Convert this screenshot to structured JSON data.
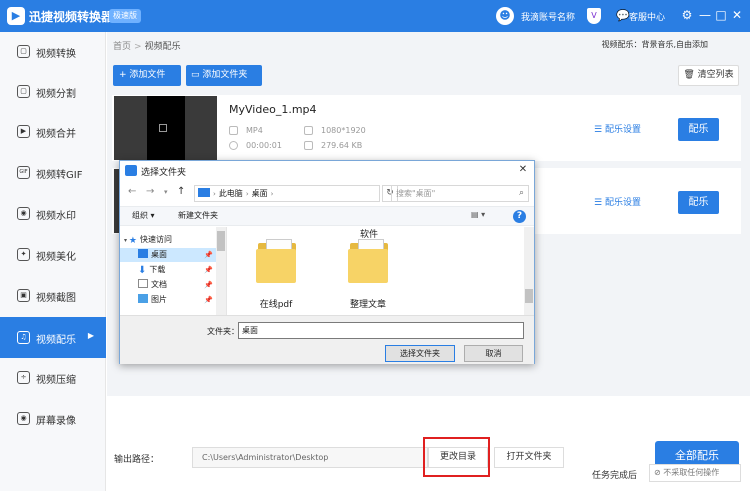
{
  "app": {
    "title": "迅捷视频转换器",
    "badge": "极速版",
    "user_name": "我滴账号名称",
    "vip_icon": "V",
    "service_label": "客服中心",
    "controls": [
      "⚙",
      "—",
      "□",
      "✕"
    ]
  },
  "sidebar": {
    "items": [
      {
        "label": "视频转换",
        "icon": "▢"
      },
      {
        "label": "视频分割",
        "icon": "▢"
      },
      {
        "label": "视频合并",
        "icon": "▶"
      },
      {
        "label": "视频转GIF",
        "icon": "GIF"
      },
      {
        "label": "视频水印",
        "icon": "◉"
      },
      {
        "label": "视频美化",
        "icon": "✦"
      },
      {
        "label": "视频截图",
        "icon": "▣"
      },
      {
        "label": "视频配乐",
        "icon": "♫",
        "active": true
      },
      {
        "label": "视频压缩",
        "icon": "÷"
      },
      {
        "label": "屏幕录像",
        "icon": "◉"
      }
    ]
  },
  "breadcrumb": {
    "home": "首页",
    "sep": ">",
    "current": "视频配乐"
  },
  "mode_label": "视频配乐：背景音乐,自由添加",
  "toolbar": {
    "add_file": "+ 添加文件",
    "add_folder": "添加文件夹",
    "clear_list": "清空列表"
  },
  "videos": [
    {
      "name": "MyVideo_1.mp4",
      "format": "MP4",
      "resolution": "1080*1920",
      "duration": "00:00:01",
      "size": "279.64 KB",
      "music_settings": "配乐设置",
      "music_button": "配乐"
    },
    {
      "music_settings": "配乐设置",
      "music_button": "配乐"
    }
  ],
  "output": {
    "label": "输出路径：",
    "path": "C:\\Users\\Administrator\\Desktop",
    "change_dir": "更改目录",
    "open_folder": "打开文件夹",
    "all_music": "全部配乐"
  },
  "status": {
    "task_done_label": "任务完成后",
    "task_done_value": "⊘ 不采取任何操作"
  },
  "dialog": {
    "title": "选择文件夹",
    "address": [
      "此电脑",
      "桌面"
    ],
    "search_placeholder": "搜索\"桌面\"",
    "organize": "组织 ▾",
    "new_folder": "新建文件夹",
    "nav_items": [
      {
        "label": "快速访问",
        "icon": "star-icon",
        "color": "#2a7ee3"
      },
      {
        "label": "桌面",
        "icon": "desktop-icon",
        "color": "#2a7ee3",
        "selected": true
      },
      {
        "label": "下载",
        "icon": "download-icon",
        "color": "#2a7ee3"
      },
      {
        "label": "文档",
        "icon": "document-icon",
        "color": "#8a8a8a"
      },
      {
        "label": "图片",
        "icon": "picture-icon",
        "color": "#4aa0e6"
      }
    ],
    "folders": [
      {
        "label": "在线pdf"
      },
      {
        "label": "整理文章"
      }
    ],
    "partial_label": "软件",
    "folder_field_label": "文件夹：",
    "folder_field_value": "桌面",
    "select_button": "选择文件夹",
    "cancel_button": "取消"
  },
  "colors": {
    "accent": "#2a7ee3",
    "highlight": "#e02020"
  }
}
